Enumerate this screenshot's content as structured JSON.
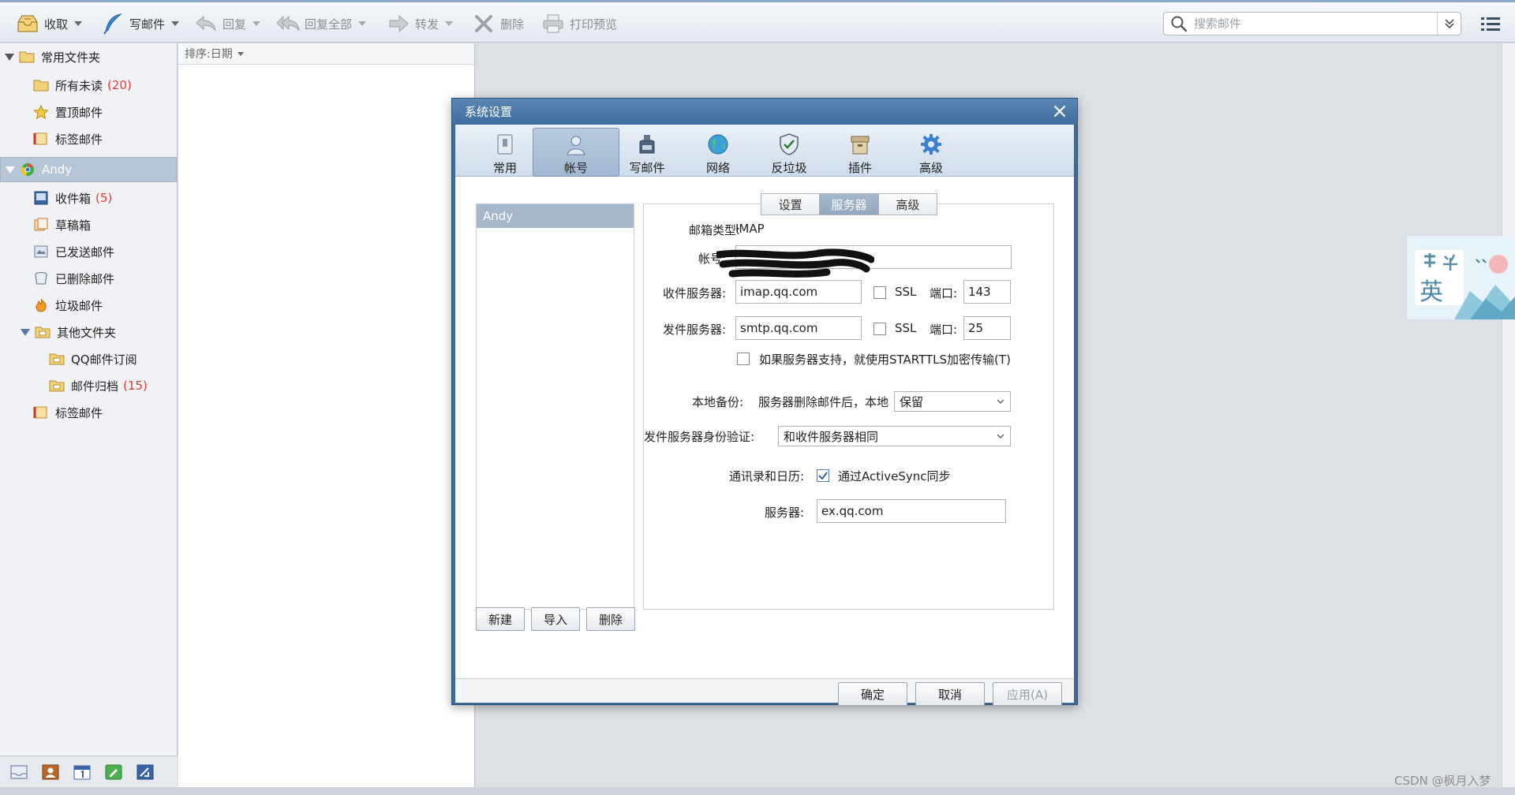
{
  "toolbar": {
    "receive": "收取",
    "compose": "写邮件",
    "reply": "回复",
    "reply_all": "回复全部",
    "forward": "转发",
    "delete": "删除",
    "print_preview": "打印预览",
    "search_placeholder": "搜索邮件"
  },
  "folders": {
    "common_group": "常用文件夹",
    "all_unread": "所有未读",
    "all_unread_count": "(20)",
    "pinned": "置顶邮件",
    "tagged": "标签邮件",
    "account": "Andy",
    "inbox": "收件箱",
    "inbox_count": "(5)",
    "drafts": "草稿箱",
    "sent": "已发送邮件",
    "deleted": "已删除邮件",
    "spam": "垃圾邮件",
    "other_group": "其他文件夹",
    "qq_subscriptions": "QQ邮件订阅",
    "archive": "邮件归档",
    "archive_count": "(15)",
    "tagged2": "标签邮件"
  },
  "list": {
    "sort_label": "排序:日期"
  },
  "dialog": {
    "title": "系统设置",
    "tabs": [
      "常用",
      "帐号",
      "写邮件",
      "网络",
      "反垃圾",
      "插件",
      "高级"
    ],
    "active_tab": "帐号",
    "account_list": [
      "Andy"
    ],
    "subtabs": [
      "设置",
      "服务器",
      "高级"
    ],
    "active_subtab": "服务器",
    "mailbox_type_label": "邮箱类型:",
    "mailbox_type_value": "IMAP",
    "account_label": "帐号:",
    "account_value": "",
    "incoming_label": "收件服务器:",
    "incoming_value": "imap.qq.com",
    "incoming_ssl": "SSL",
    "incoming_ssl_checked": false,
    "incoming_port_label": "端口:",
    "incoming_port": "143",
    "outgoing_label": "发件服务器:",
    "outgoing_value": "smtp.qq.com",
    "outgoing_ssl": "SSL",
    "outgoing_ssl_checked": false,
    "outgoing_port_label": "端口:",
    "outgoing_port": "25",
    "starttls_label": "如果服务器支持，就使用STARTTLS加密传输(T)",
    "starttls_checked": false,
    "local_backup_label": "本地备份:",
    "local_backup_text": "服务器删除邮件后，本地",
    "local_backup_option": "保留",
    "smtp_auth_label": "发件服务器身份验证:",
    "smtp_auth_option": "和收件服务器相同",
    "contacts_label": "通讯录和日历:",
    "activesync_label": "通过ActiveSync同步",
    "activesync_checked": true,
    "server_label": "服务器:",
    "server_value": "ex.qq.com",
    "new_button": "新建",
    "import_button": "导入",
    "delete_button": "删除",
    "ok_button": "确定",
    "cancel_button": "取消",
    "apply_button": "应用(A)"
  },
  "watermark": "CSDN @枫月入梦",
  "ad_widget": {
    "text": "英"
  },
  "colors": {
    "accent": "#3d6a98",
    "unread_count": "#e03c31",
    "selected_folder": "#b7c5d8"
  }
}
